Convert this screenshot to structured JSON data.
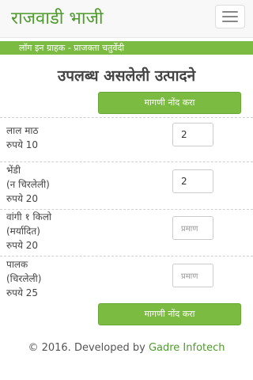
{
  "navbar": {
    "brand": "राजवाडी भाजी"
  },
  "login_info": "लॉग इन ग्राहक - प्राजक्ता चतुर्वेदी",
  "page_title": "उपलब्ध असलेली उत्पादने",
  "order_button_label": "मागणी नोंद करा",
  "products": [
    {
      "lines": [
        "लाल माठ",
        "रुपये 10"
      ],
      "quantity": "2",
      "placeholder": ""
    },
    {
      "lines": [
        "भेंडी",
        "(न चिरलेली)",
        "रुपये 20"
      ],
      "quantity": "2",
      "placeholder": ""
    },
    {
      "lines": [
        "वांगी १ किलो",
        "(मर्यादित)",
        "रुपये 20"
      ],
      "quantity": "",
      "placeholder": "प्रमाण"
    },
    {
      "lines": [
        "पालक",
        "(चिरलेली)",
        "रुपये 25"
      ],
      "quantity": "",
      "placeholder": "प्रमाण"
    }
  ],
  "footer": {
    "text": "© 2016. Developed by ",
    "company": "Gadre Infotech"
  },
  "colors": {
    "brand_green": "#4f9b2c",
    "button_green": "#7cbb42"
  }
}
